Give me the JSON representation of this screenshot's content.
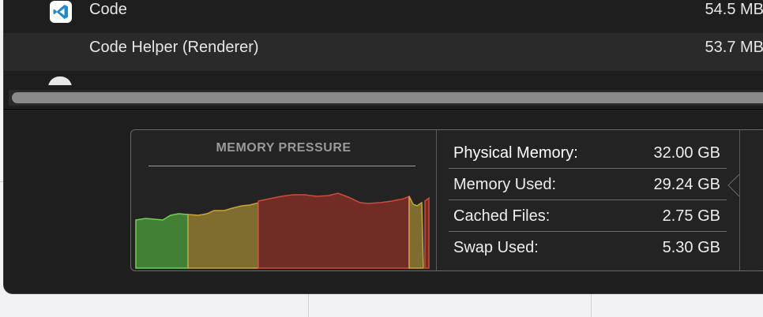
{
  "processes": [
    {
      "icon": "vscode-icon",
      "name": "Code",
      "memory": "54.5 MB"
    },
    {
      "icon": "",
      "name": "Code Helper (Renderer)",
      "memory": "53.7 MB"
    },
    {
      "icon": "",
      "name": "",
      "memory": ""
    }
  ],
  "memory_pressure": {
    "title": "MEMORY PRESSURE",
    "colors": {
      "green": "#4a9a3a",
      "yellow": "#8f7a32",
      "red": "#7a2e26"
    }
  },
  "stats": [
    {
      "label": "Physical Memory:",
      "value": "32.00 GB"
    },
    {
      "label": "Memory Used:",
      "value": "29.24 GB"
    },
    {
      "label": "Cached Files:",
      "value": "2.75 GB"
    },
    {
      "label": "Swap Used:",
      "value": "5.30 GB"
    }
  ]
}
